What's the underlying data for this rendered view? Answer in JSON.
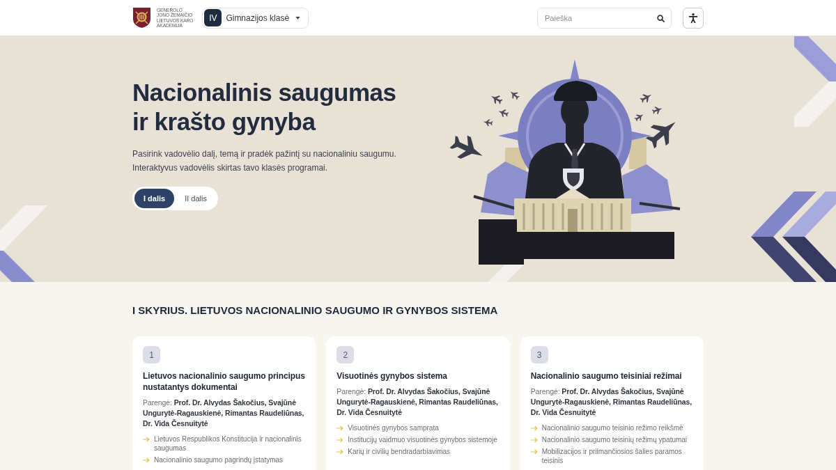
{
  "header": {
    "logo_lines": [
      "GENEROLO",
      "JONO ŽEMAIČIO",
      "LIETUVOS KARO",
      "AKADEMIJA"
    ],
    "class_select": {
      "badge": "IV",
      "label": "Gimnazijos klasė"
    },
    "search": {
      "placeholder": "Paieška"
    }
  },
  "hero": {
    "title_lines": [
      "Nacionalinis saugumas",
      "ir krašto gynyba"
    ],
    "description_lines": [
      "Pasirink vadovėlio dalį, temą ir pradėk pažintį su nacionaliniu saugumu.",
      "Interaktyvus vadovėlis skirtas tavo klasės programai."
    ],
    "parts": [
      {
        "label": "I dalis",
        "selected": true
      },
      {
        "label": "II dalis",
        "selected": false
      }
    ]
  },
  "chapter": {
    "heading": "I SKYRIUS. LIETUVOS NACIONALINIO SAUGUMO IR GYNYBOS SISTEMA",
    "cards": [
      {
        "number": "1",
        "title": "Lietuvos nacionalinio saugumo principus nustatantys dokumentai",
        "authors": "Parengė: **Prof. Dr. Alvydas Šakočius, Svajūnė Ungurytė-Ragauskienė, Rimantas Raudeliūnas, Dr. Vida Česnuitytė**",
        "topics": [
          "Lietuvos Respublikos Konstitucija ir nacionalinis saugumas",
          "Nacionalinio saugumo pagrindų įstatymas"
        ]
      },
      {
        "number": "2",
        "title": "Visuotinės gynybos sistema",
        "authors": "Parengė: **Prof. Dr. Alvydas Šakočius, Svajūnė Ungurytė-Ragauskienė, Rimantas Raudeliūnas, Dr. Vida Česnuitytė**",
        "topics": [
          "Visuotinės gynybos samprata",
          "Institucijų vaidmuo visuotinės gynybos sistemoje",
          "Karių ir civilių bendradarbiavimas"
        ]
      },
      {
        "number": "3",
        "title": "Nacionalinio saugumo teisiniai režimai",
        "authors": "Parengė: **Prof. Dr. Alvydas Šakočius, Svajūnė Ungurytė-Ragauskienė, Rimantas Raudeliūnas, Dr. Vida Česnuitytė**",
        "topics": [
          "Nacionalinio saugumo teisinio režimo reikšmė",
          "Nacionalinio saugumo teisinių režimų ypatumai",
          "Mobilizacijos ir priimančiosios šalies paramos teisinis"
        ]
      }
    ]
  }
}
